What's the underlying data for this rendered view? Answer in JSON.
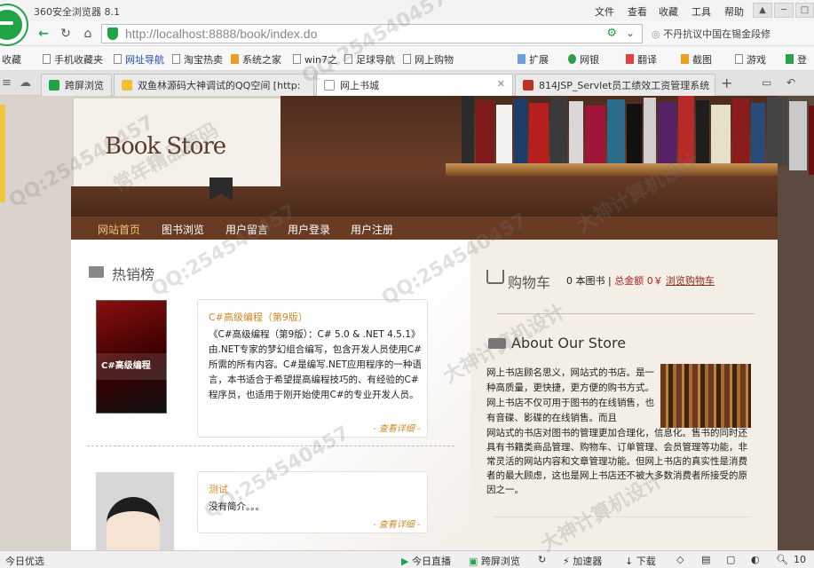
{
  "browser": {
    "title": "360安全浏览器 8.1",
    "menu": [
      "文件",
      "查看",
      "收藏",
      "工具",
      "帮助"
    ],
    "url": "http://localhost:8888/book/index.do",
    "address_right": "不丹抗议中国在锡金段修",
    "bookmarks": [
      "收藏",
      "手机收藏夹",
      "网址导航",
      "淘宝热卖",
      "系统之家",
      "win7之",
      "足球导航",
      "网上购物",
      "扩展",
      "网银",
      "翻译",
      "截图",
      "游戏",
      "登"
    ],
    "tabs": [
      "跨屏浏览",
      "双鱼林源码大神调试的QQ空间 [http:",
      "网上书城",
      "814JSP_Servlet员工绩效工资管理系统"
    ],
    "status": [
      "今日优选",
      "今日直播",
      "跨屏浏览",
      "加速器",
      "下载",
      "10"
    ]
  },
  "site": {
    "brand": "Book Store",
    "nav": [
      "网站首页",
      "图书浏览",
      "用户留言",
      "用户登录",
      "用户注册"
    ],
    "hot_title": "热销榜",
    "books": [
      {
        "cover_text": "C#高级编程",
        "title": "C#高级编程（第9版）",
        "desc": "《C#高级编程（第9版）：C# 5.0 & .NET 4.5.1》由.NET专家的梦幻组合编写，包含开发人员使用C#所需的所有内容。C#是编写.NET应用程序的一种语言，本书适合于希望提高编程技巧的、有经验的C#程序员，也适用于刚开始使用C#的专业开发人员。",
        "more": "- 查看详细 -"
      },
      {
        "title": "测试",
        "desc": "没有简介。。。",
        "more": "- 查看详细 -"
      }
    ],
    "cart": {
      "title": "购物车",
      "count": "0 本图书",
      "sep": " | ",
      "total": "总金额 0￥",
      "link": "浏览购物车"
    },
    "about": {
      "title": "About Our Store",
      "text1": "网上书店顾名思义，网站式的书店。是一种高质量，更快捷，更方便的购书方式。网上书店不仅可用于图书的在线销售，也有音碟、影碟的在线销售。而且",
      "text2": "网站式的书店对图书的管理更加合理化，信息化。售书的同时还具有书籍类商品管理、购物车、订单管理、会员管理等功能，非常灵活的网站内容和文章管理功能。但网上书店的真实性是消费者的最大顾虑，这也是网上书店还不被大多数消费者所接受的原因之一。"
    }
  },
  "watermark": [
    "QQ:254540457",
    "大神计算机设计",
    "常年精品源码"
  ]
}
